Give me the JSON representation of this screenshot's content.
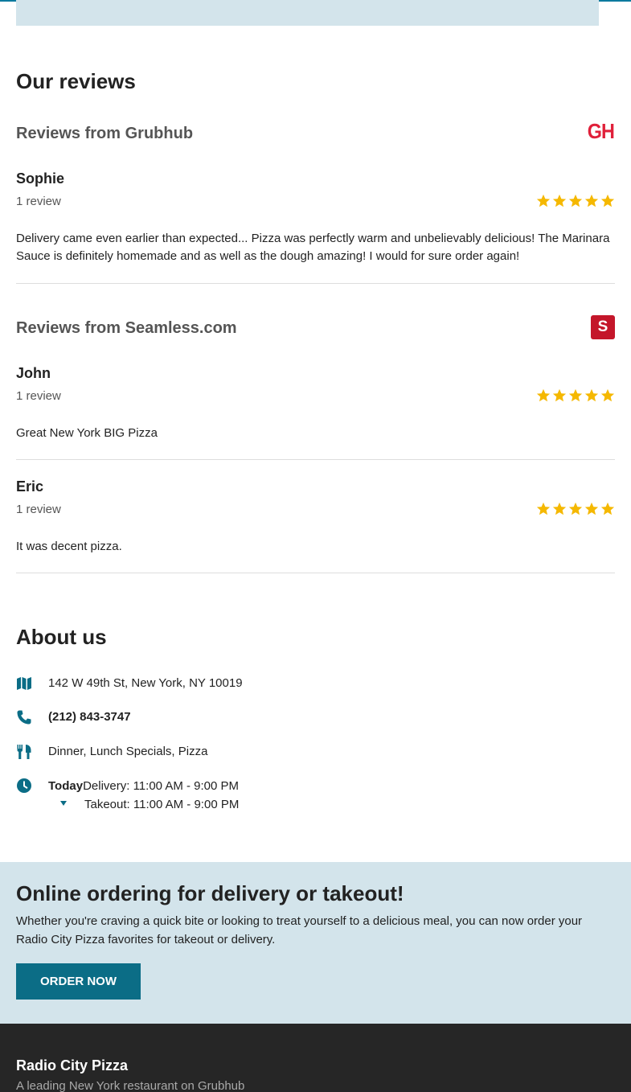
{
  "reviews_section": {
    "title": "Our reviews",
    "sources": [
      {
        "name": "Reviews from Grubhub",
        "logo_text": "GH",
        "reviews": [
          {
            "name": "Sophie",
            "count": "1 review",
            "rating": 5,
            "text": "Delivery came even earlier than expected... Pizza was perfectly warm and unbelievably delicious! The Marinara Sauce is definitely homemade and as well as the dough amazing! I would for sure order again!"
          }
        ]
      },
      {
        "name": "Reviews from Seamless.com",
        "logo_text": "S",
        "reviews": [
          {
            "name": "John",
            "count": "1 review",
            "rating": 5,
            "text": "Great New York BIG Pizza"
          },
          {
            "name": "Eric",
            "count": "1 review",
            "rating": 5,
            "text": "It was decent pizza."
          }
        ]
      }
    ]
  },
  "about": {
    "title": "About us",
    "address": "142 W 49th St, New York, NY 10019",
    "phone": "(212) 843-3747",
    "categories": "Dinner, Lunch Specials, Pizza",
    "hours": {
      "today_label": "Today",
      "delivery": "Delivery: 11:00 AM - 9:00 PM",
      "takeout": "Takeout: 11:00 AM - 9:00 PM"
    }
  },
  "order": {
    "title": "Online ordering for delivery or takeout!",
    "text": "Whether you're craving a quick bite or looking to treat yourself to a delicious meal, you can now order your Radio City Pizza favorites for takeout or delivery.",
    "button": "ORDER NOW"
  },
  "footer": {
    "name": "Radio City Pizza",
    "subtitle": "A leading New York restaurant on Grubhub"
  },
  "colors": {
    "accent": "#0b6d86",
    "star": "#f5b800",
    "panel": "#d3e4eb",
    "footer": "#262626"
  }
}
